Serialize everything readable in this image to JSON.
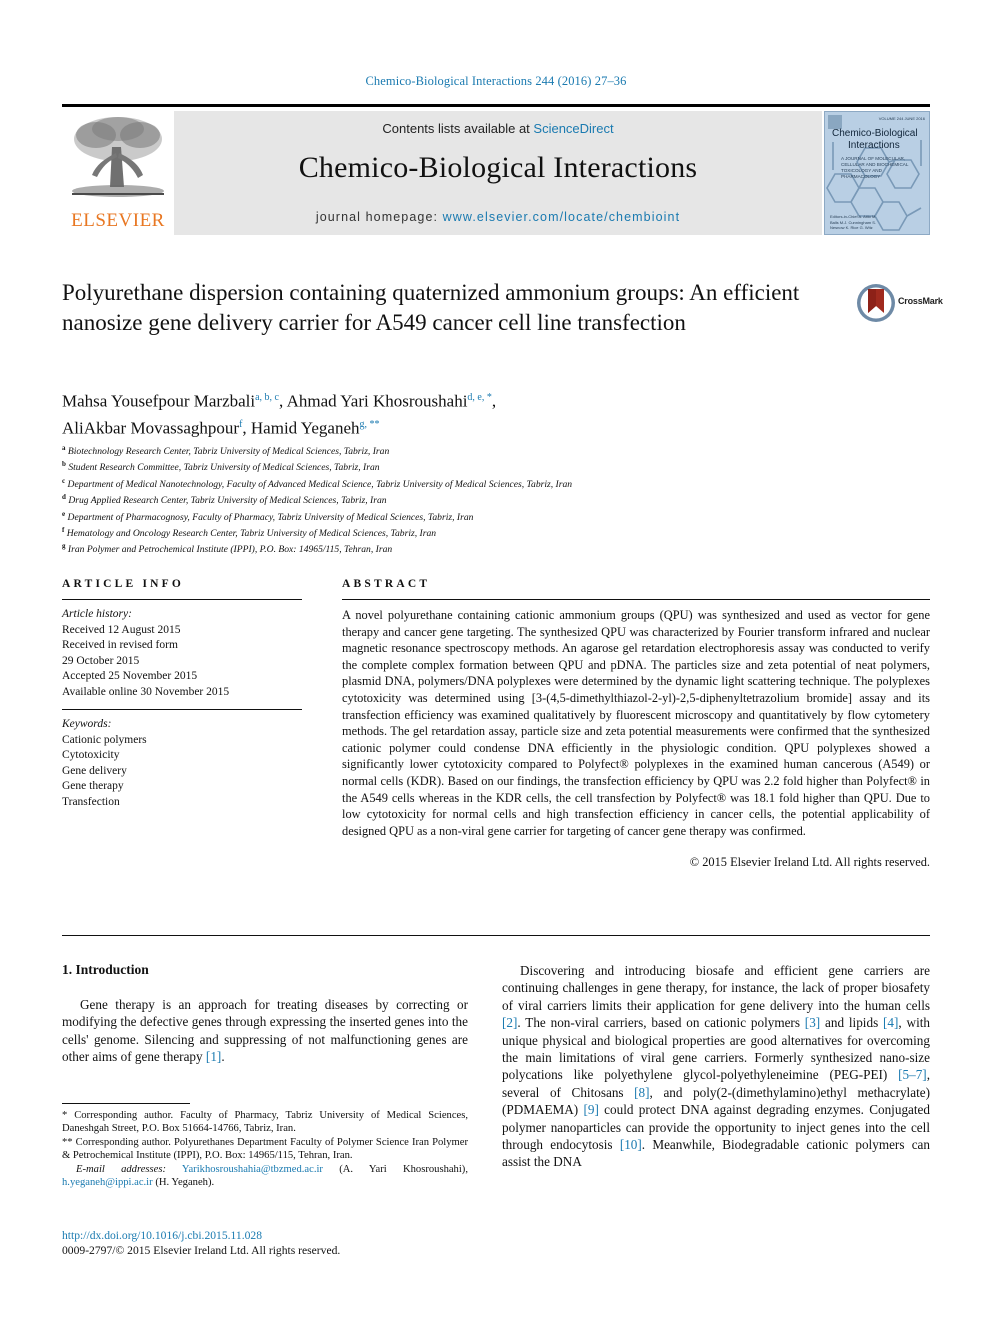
{
  "running_head": "Chemico-Biological Interactions 244 (2016) 27–36",
  "masthead": {
    "publisher_name": "ELSEVIER",
    "contents_prefix": "Contents lists available at ",
    "contents_link": "ScienceDirect",
    "journal_title": "Chemico-Biological Interactions",
    "homepage_prefix": "journal homepage: ",
    "homepage_url": "www.elsevier.com/locate/chembioint",
    "cover": {
      "title_line1": "Chemico-Biological",
      "title_line2": "Interactions",
      "subtitle": "A JOURNAL OF MOLECULAR, CELLULAR AND BIOCHEMICAL TOXICOLOGY AND PHARMACOLOGY",
      "topright": "VOLUME 244\nJUNE 2016",
      "footer": "Editors-in-Chief\nA. Aitio\nM. Balls\nM.J. Cunningham\nS. Nesnow\nK. Rice\nG. Witz"
    }
  },
  "article": {
    "title": "Polyurethane dispersion containing quaternized ammonium groups: An efficient nanosize gene delivery carrier for A549 cancer cell line transfection",
    "crossmark_label": "CrossMark",
    "authors_line1": "Mahsa Yousefpour Marzbali",
    "authors_line1_sup": "a, b, c",
    "author2": "Ahmad Yari Khosroushahi",
    "author2_sup": "d, e, *",
    "authors_line2": "AliAkbar Movassaghpour",
    "authors_line2_sup": "f",
    "author4": "Hamid Yeganeh",
    "author4_sup": "g, **",
    "affiliations": [
      {
        "mark": "a",
        "text": "Biotechnology Research Center, Tabriz University of Medical Sciences, Tabriz, Iran"
      },
      {
        "mark": "b",
        "text": "Student Research Committee, Tabriz University of Medical Sciences, Tabriz, Iran"
      },
      {
        "mark": "c",
        "text": "Department of Medical Nanotechnology, Faculty of Advanced Medical Science, Tabriz University of Medical Sciences, Tabriz, Iran"
      },
      {
        "mark": "d",
        "text": "Drug Applied Research Center, Tabriz University of Medical Sciences, Tabriz, Iran"
      },
      {
        "mark": "e",
        "text": "Department of Pharmacognosy, Faculty of Pharmacy, Tabriz University of Medical Sciences, Tabriz, Iran"
      },
      {
        "mark": "f",
        "text": "Hematology and Oncology Research Center, Tabriz University of Medical Sciences, Tabriz, Iran"
      },
      {
        "mark": "g",
        "text": "Iran Polymer and Petrochemical Institute (IPPI), P.O. Box: 14965/115, Tehran, Iran"
      }
    ]
  },
  "article_info": {
    "heading": "ARTICLE INFO",
    "history_label": "Article history:",
    "history": [
      "Received 12 August 2015",
      "Received in revised form",
      "29 October 2015",
      "Accepted 25 November 2015",
      "Available online 30 November 2015"
    ],
    "keywords_label": "Keywords:",
    "keywords": [
      "Cationic polymers",
      "Cytotoxicity",
      "Gene delivery",
      "Gene therapy",
      "Transfection"
    ]
  },
  "abstract": {
    "heading": "ABSTRACT",
    "text": "A novel polyurethane containing cationic ammonium groups (QPU) was synthesized and used as vector for gene therapy and cancer gene targeting. The synthesized QPU was characterized by Fourier transform infrared and nuclear magnetic resonance spectroscopy methods. An agarose gel retardation electrophoresis assay was conducted to verify the complete complex formation between QPU and pDNA. The particles size and zeta potential of neat polymers, plasmid DNA, polymers/DNA polyplexes were determined by the dynamic light scattering technique. The polyplexes cytotoxicity was determined using [3-(4,5-dimethylthiazol-2-yl)-2,5-diphenyltetrazolium bromide] assay and its transfection efficiency was examined qualitatively by fluorescent microscopy and quantitatively by flow cytometery methods. The gel retardation assay, particle size and zeta potential measurements were confirmed that the synthesized cationic polymer could condense DNA efficiently in the physiologic condition. QPU polyplexes showed a significantly lower cytotoxicity compared to Polyfect® polyplexes in the examined human cancerous (A549) or normal cells (KDR). Based on our findings, the transfection efficiency by QPU was 2.2 fold higher than Polyfect® in the A549 cells whereas in the KDR cells, the cell transfection by Polyfect® was 18.1 fold higher than QPU. Due to low cytotoxicity for normal cells and high transfection efficiency in cancer cells, the potential applicability of designed QPU as a non-viral gene carrier for targeting of cancer gene therapy was confirmed.",
    "copyright": "© 2015 Elsevier Ireland Ltd. All rights reserved."
  },
  "introduction": {
    "heading": "1. Introduction",
    "left_paragraph_pre": "Gene therapy is an approach for treating diseases by correcting or modifying the defective genes through expressing the inserted genes into the cells' genome. Silencing and suppressing of not malfunctioning genes are other aims of gene therapy ",
    "left_citation": "[1]",
    "left_paragraph_post": ".",
    "right_p1_a": "Discovering and introducing biosafe and efficient gene carriers are continuing challenges in gene therapy, for instance, the lack of proper biosafety of viral carriers limits their application for gene delivery into the human cells ",
    "right_c1": "[2]",
    "right_p1_b": ". The non-viral carriers, based on cationic polymers ",
    "right_c2": "[3]",
    "right_p1_c": " and lipids ",
    "right_c3": "[4]",
    "right_p1_d": ", with unique physical and biological properties are good alternatives for overcoming the main limitations of viral gene carriers. Formerly synthesized nano-size polycations like polyethylene glycol-polyethyleneimine (PEG-PEI) ",
    "right_c4": "[5–7]",
    "right_p1_e": ", several of Chitosans ",
    "right_c5": "[8]",
    "right_p1_f": ", and poly(2-(dimethylamino)ethyl methacrylate) (PDMAEMA) ",
    "right_c6": "[9]",
    "right_p1_g": " could protect DNA against degrading enzymes. Conjugated polymer nanoparticles can provide the opportunity to inject genes into the cell through endocytosis ",
    "right_c7": "[10]",
    "right_p1_h": ". Meanwhile, Biodegradable cationic polymers can assist the DNA"
  },
  "footnotes": {
    "corresponding1_mark": "*",
    "corresponding1": " Corresponding author. Faculty of Pharmacy, Tabriz University of Medical Sciences, Daneshgah Street, P.O. Box 51664-14766, Tabriz, Iran.",
    "corresponding2_mark": "**",
    "corresponding2": " Corresponding author. Polyurethanes Department Faculty of Polymer Science Iran Polymer & Petrochemical Institute (IPPI), P.O. Box: 14965/115, Tehran, Iran.",
    "email_label": "E-mail addresses:",
    "email1": "Yarikhosroushahia@tbzmed.ac.ir",
    "email1_owner": "(A. Yari Khosroushahi)",
    "email2": "h.yeganeh@ippi.ac.ir",
    "email2_owner": "(H. Yeganeh)",
    "doi": "http://dx.doi.org/10.1016/j.cbi.2015.11.028",
    "issn_line": "0009-2797/© 2015 Elsevier Ireland Ltd. All rights reserved."
  },
  "colors": {
    "link": "#1a7ab0",
    "elsevier_orange": "#E87722",
    "masthead_grey": "#e6e6e6",
    "cover_blue": "#b9cfe4",
    "crossmark_red": "#a02a1e"
  }
}
